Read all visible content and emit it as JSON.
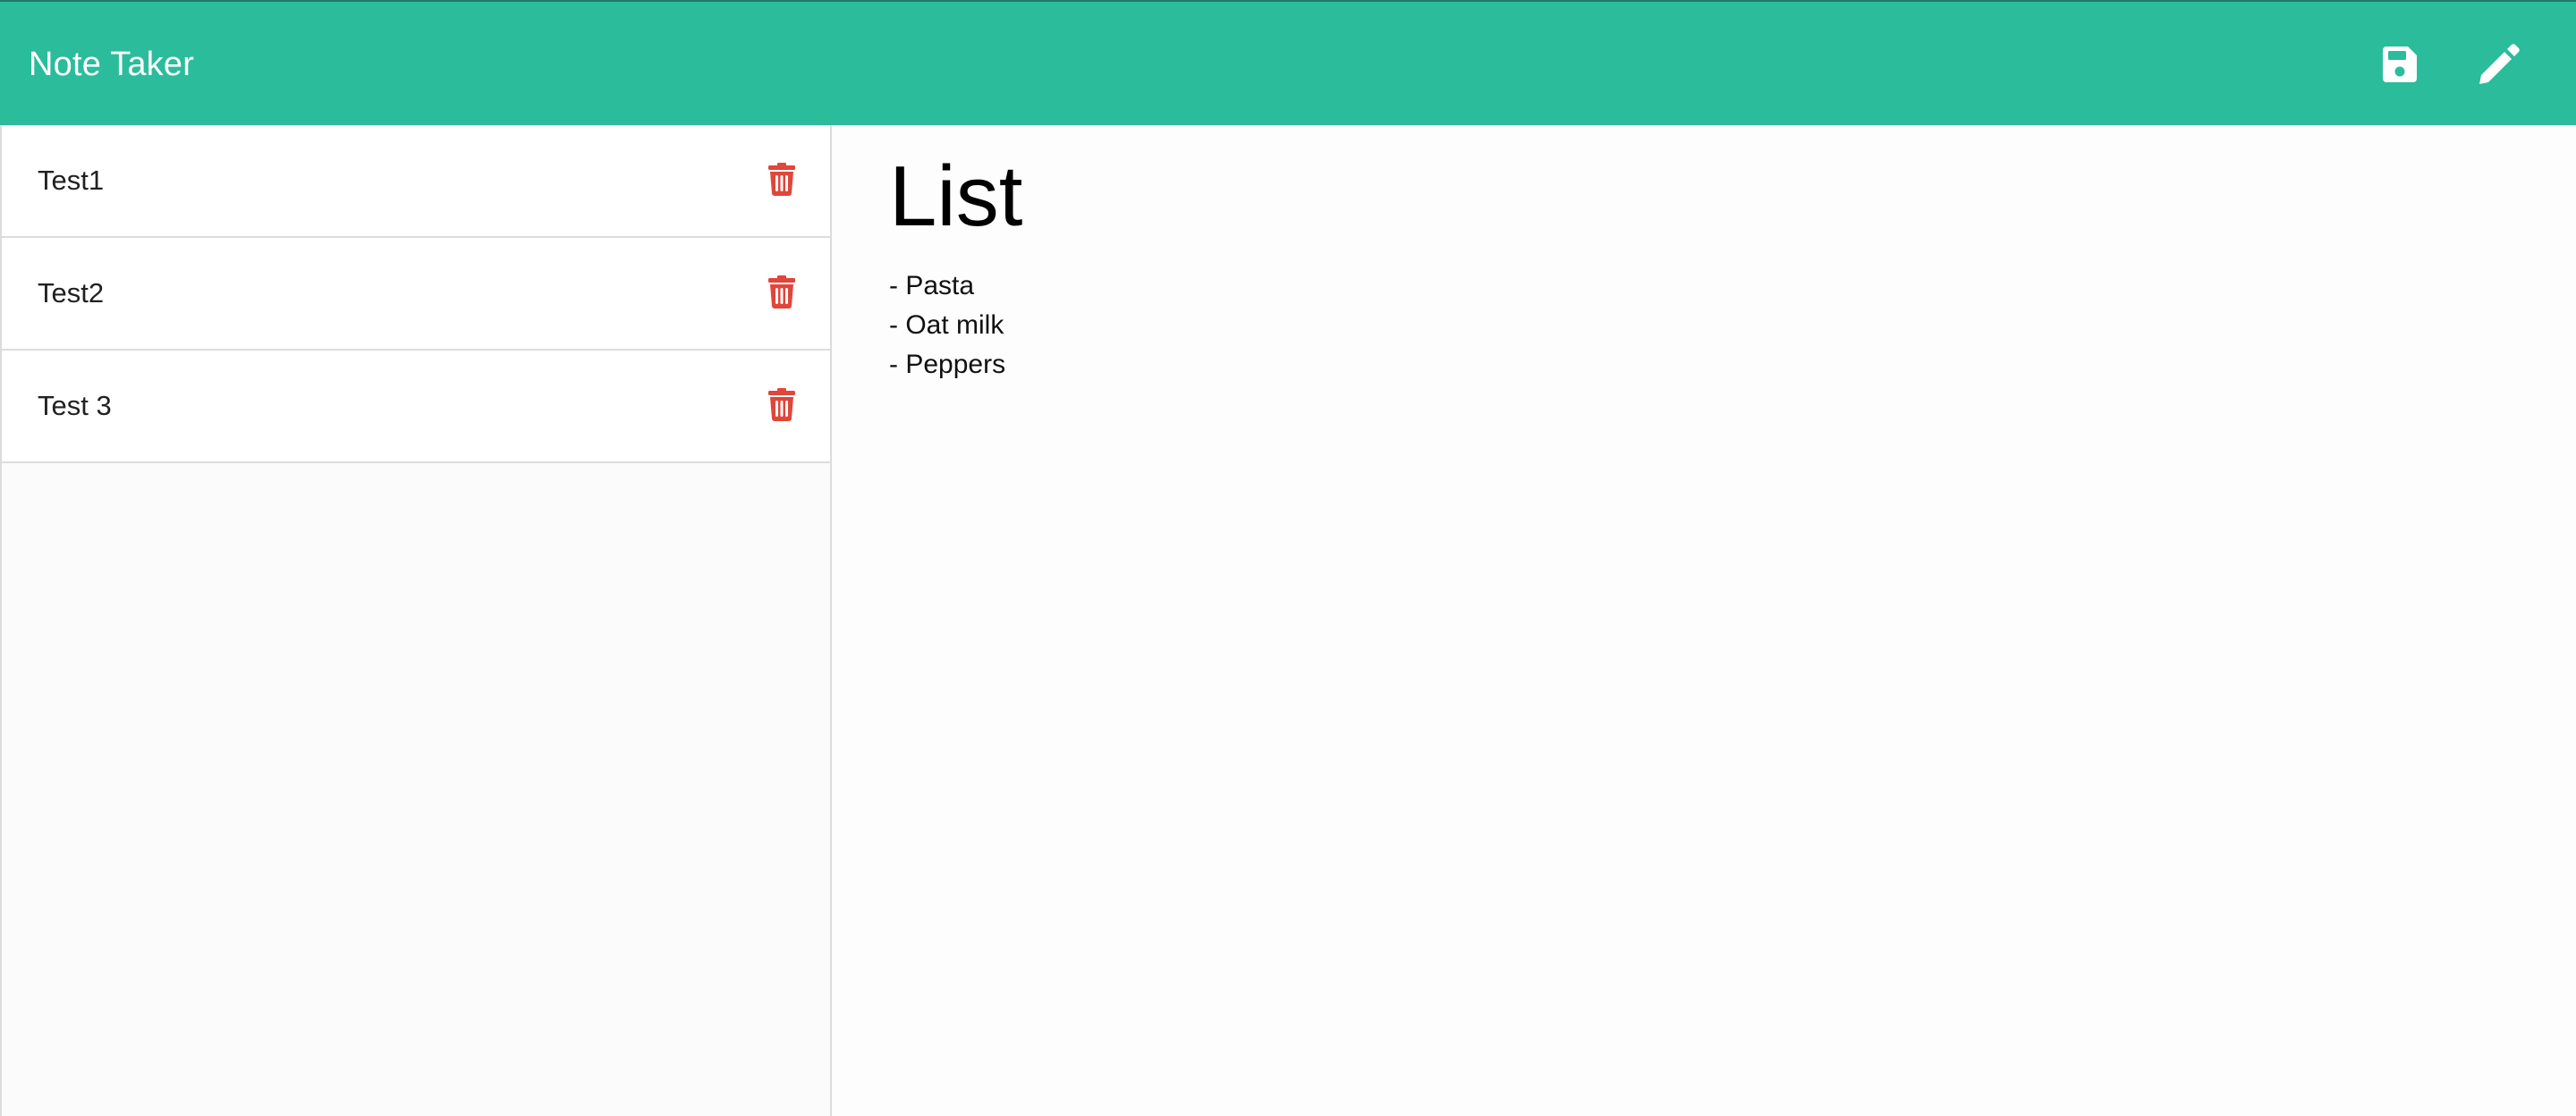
{
  "app": {
    "brand": "Note Taker"
  },
  "colors": {
    "navbar": "#2bbc9c",
    "delete": "#e0463a",
    "icon": "#ffffff"
  },
  "toolbar": {
    "save_icon": "save-icon",
    "new_note_icon": "pencil-icon"
  },
  "notes": [
    {
      "title": "Test1",
      "delete_icon": "trash-icon"
    },
    {
      "title": "Test2",
      "delete_icon": "trash-icon"
    },
    {
      "title": "Test 3",
      "delete_icon": "trash-icon"
    }
  ],
  "active_note": {
    "title": "List",
    "text": "- Pasta\n- Oat milk\n- Peppers"
  }
}
